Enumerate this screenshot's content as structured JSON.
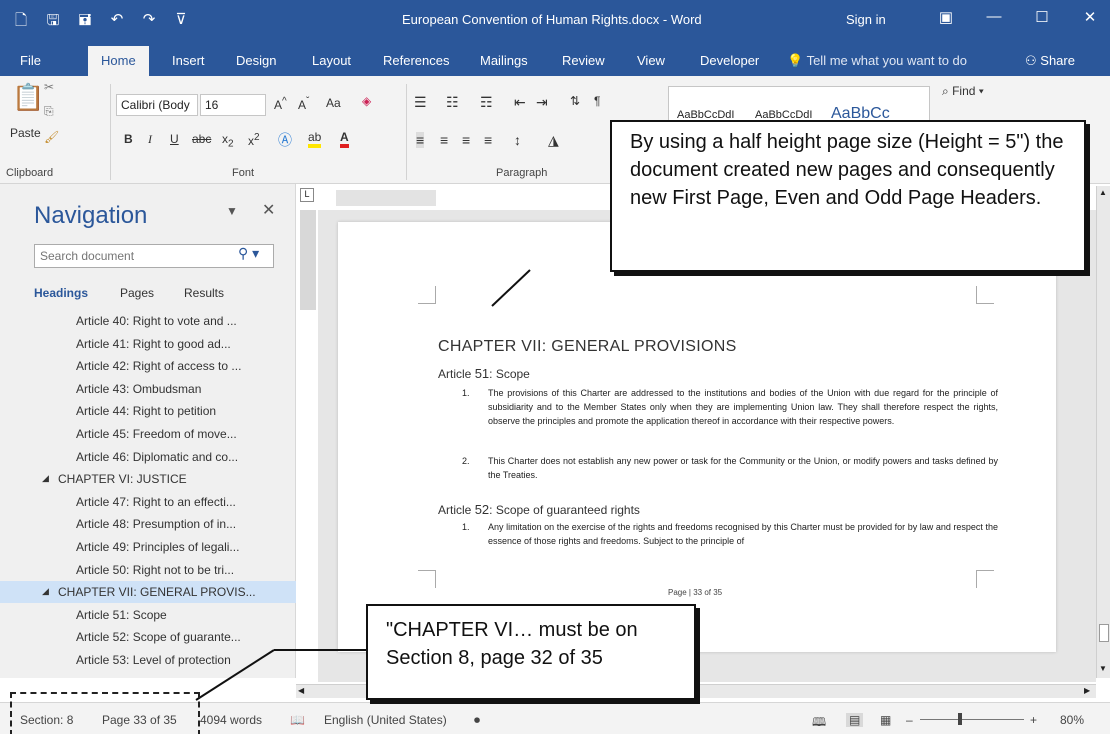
{
  "window": {
    "title": "European Convention of Human Rights.docx - Word",
    "sign_in": "Sign in",
    "brand_color": "#2b579a"
  },
  "ribbon_tabs": [
    "File",
    "Home",
    "Insert",
    "Design",
    "Layout",
    "References",
    "Mailings",
    "Review",
    "View",
    "Developer"
  ],
  "tell_me": "Tell me what you want to do",
  "share": "Share",
  "ribbon": {
    "paste": "Paste",
    "font_name": "Calibri (Body",
    "font_size": "16",
    "change_case": "Aa",
    "find": "Find",
    "styles_preview": [
      "AaBbCcDdI",
      "AaBbCcDdI",
      "AaBbCc"
    ],
    "groups": {
      "clipboard": "Clipboard",
      "font": "Font",
      "paragraph": "Paragraph"
    }
  },
  "navigation": {
    "title": "Navigation",
    "search_placeholder": "Search document",
    "tabs": [
      "Headings",
      "Pages",
      "Results"
    ],
    "items": [
      {
        "label": "Article 40: Right to vote and ...",
        "level": 2
      },
      {
        "label": "Article 41: Right to good ad...",
        "level": 2
      },
      {
        "label": "Article 42: Right of access to ...",
        "level": 2
      },
      {
        "label": "Article 43: Ombudsman",
        "level": 2
      },
      {
        "label": "Article 44: Right to petition",
        "level": 2
      },
      {
        "label": "Article 45: Freedom of move...",
        "level": 2
      },
      {
        "label": "Article 46: Diplomatic and co...",
        "level": 2
      },
      {
        "label": "CHAPTER VI: JUSTICE",
        "level": 1
      },
      {
        "label": "Article 47: Right to an effecti...",
        "level": 2
      },
      {
        "label": "Article 48: Presumption of in...",
        "level": 2
      },
      {
        "label": "Article 49: Principles of legali...",
        "level": 2
      },
      {
        "label": "Article 50: Right not to be tri...",
        "level": 2
      },
      {
        "label": "CHAPTER VII: GENERAL PROVIS...",
        "level": 1,
        "selected": true
      },
      {
        "label": "Article 51: Scope",
        "level": 2
      },
      {
        "label": "Article 52: Scope of guarante...",
        "level": 2
      },
      {
        "label": "Article 53: Level of protection",
        "level": 2
      }
    ]
  },
  "document": {
    "chapter_heading": "CHAPTER VII: GENERAL PROVISIONS",
    "article51": {
      "prefix": "Article",
      "num": "51",
      "title": ": Scope"
    },
    "para1_num": "1.",
    "para1": "The provisions of this Charter are addressed to the institutions and bodies of the Union with due regard for the principle of subsidiarity and to the Member States only when they are implementing Union law. They shall therefore respect the rights, observe the principles and promote the application thereof in accordance with their respective powers.",
    "para2_num": "2.",
    "para2": "This Charter does not establish any new power or task for the Community or the Union, or modify powers and tasks defined by the Treaties.",
    "article52": {
      "prefix": "Article",
      "num": "52",
      "title": ": Scope of guaranteed rights"
    },
    "para3_num": "1.",
    "para3": "Any limitation on the exercise of the rights and freedoms recognised by this Charter must be provided for by law and respect the essence of those rights and freedoms. Subject to the principle of",
    "footer": "Page | 33 of 35"
  },
  "status_bar": {
    "section": "Section: 8",
    "page": "Page 33 of 35",
    "words": "4094 words",
    "language": "English (United States)",
    "zoom": "80%"
  },
  "callouts": {
    "top": "By using a half height page size (Height = 5\") the document created new pages and consequently new First Page, Even and Odd Page Headers.",
    "bottom": "\"CHAPTER VI… must be on Section 8, page 32 of 35"
  }
}
